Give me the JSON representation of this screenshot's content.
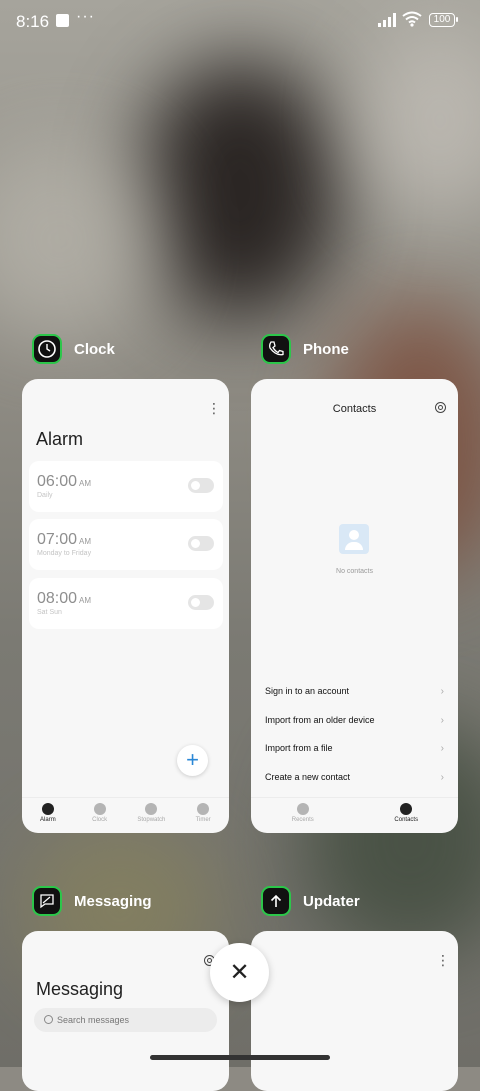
{
  "status": {
    "time": "8:16",
    "battery": "100"
  },
  "apps": {
    "clock": {
      "name": "Clock",
      "title": "Alarm",
      "alarms": [
        {
          "time": "06:00",
          "ampm": "AM",
          "repeat": "Daily"
        },
        {
          "time": "07:00",
          "ampm": "AM",
          "repeat": "Monday to Friday"
        },
        {
          "time": "08:00",
          "ampm": "AM",
          "repeat": "Sat Sun"
        }
      ],
      "add_label": "+",
      "tabs": [
        "Alarm",
        "Clock",
        "Stopwatch",
        "Timer"
      ]
    },
    "phone": {
      "name": "Phone",
      "title": "Contacts",
      "empty": "No contacts",
      "actions": [
        "Sign in to an account",
        "Import from an older device",
        "Import from a file",
        "Create a new contact"
      ],
      "tabs": [
        "Recents",
        "Contacts"
      ]
    },
    "messaging": {
      "name": "Messaging",
      "title": "Messaging",
      "search_placeholder": "Search messages"
    },
    "updater": {
      "name": "Updater"
    }
  },
  "controls": {
    "close": "✕"
  },
  "colors": {
    "icon_border": "#2cc64a",
    "fab_plus": "#2a87d6"
  }
}
